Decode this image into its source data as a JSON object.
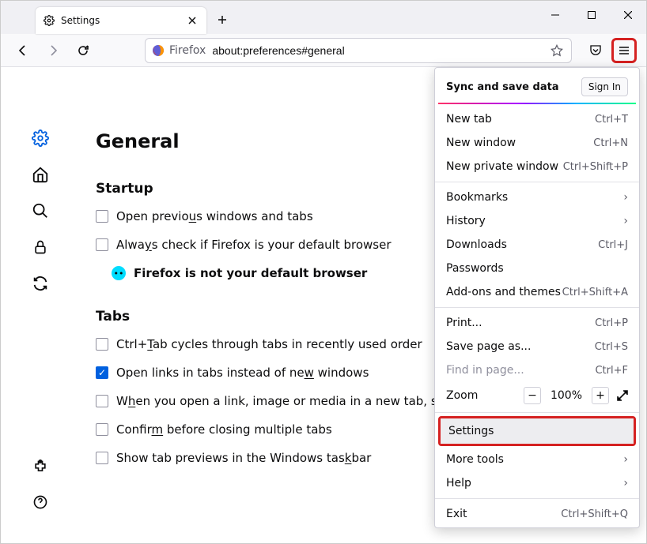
{
  "tab": {
    "title": "Settings"
  },
  "url": {
    "identity": "Firefox",
    "address": "about:preferences#general"
  },
  "page": {
    "title": "General",
    "startup": {
      "heading": "Startup",
      "open_previous": "Open previous windows and tabs",
      "always_check": "Always check if Firefox is your default browser",
      "not_default": "Firefox is not your default browser"
    },
    "tabs": {
      "heading": "Tabs",
      "ctrl_tab": "Ctrl+Tab cycles through tabs in recently used order",
      "open_links": "Open links in tabs instead of new windows",
      "switch_to": "When you open a link, image or media in a new tab, switch to",
      "confirm_close": "Confirm before closing multiple tabs",
      "taskbar_preview": "Show tab previews in the Windows taskbar"
    }
  },
  "menu": {
    "sync_header": "Sync and save data",
    "sign_in": "Sign In",
    "new_tab": {
      "label": "New tab",
      "shortcut": "Ctrl+T"
    },
    "new_window": {
      "label": "New window",
      "shortcut": "Ctrl+N"
    },
    "new_private": {
      "label": "New private window",
      "shortcut": "Ctrl+Shift+P"
    },
    "bookmarks": "Bookmarks",
    "history": "History",
    "downloads": {
      "label": "Downloads",
      "shortcut": "Ctrl+J"
    },
    "passwords": "Passwords",
    "addons": {
      "label": "Add-ons and themes",
      "shortcut": "Ctrl+Shift+A"
    },
    "print": {
      "label": "Print...",
      "shortcut": "Ctrl+P"
    },
    "save_as": {
      "label": "Save page as...",
      "shortcut": "Ctrl+S"
    },
    "find": {
      "label": "Find in page...",
      "shortcut": "Ctrl+F"
    },
    "zoom": {
      "label": "Zoom",
      "pct": "100%"
    },
    "settings": "Settings",
    "more_tools": "More tools",
    "help": "Help",
    "exit": {
      "label": "Exit",
      "shortcut": "Ctrl+Shift+Q"
    }
  }
}
